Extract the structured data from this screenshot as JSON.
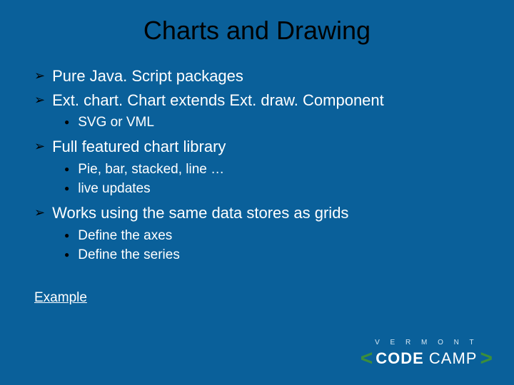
{
  "title": "Charts and Drawing",
  "bullets": {
    "b0": {
      "text": "Pure Java. Script packages"
    },
    "b1": {
      "text": "Ext. chart. Chart extends Ext. draw. Component",
      "sub": [
        "SVG or VML"
      ]
    },
    "b2": {
      "text": "Full featured chart library",
      "sub": [
        "Pie, bar, stacked, line …",
        "live updates"
      ]
    },
    "b3": {
      "text": "Works using the same data stores as grids",
      "sub": [
        "Define the axes",
        "Define the series"
      ]
    }
  },
  "example_link": "Example",
  "logo": {
    "top": "V E R M O N T",
    "code": "CODE",
    "camp": " CAMP"
  }
}
